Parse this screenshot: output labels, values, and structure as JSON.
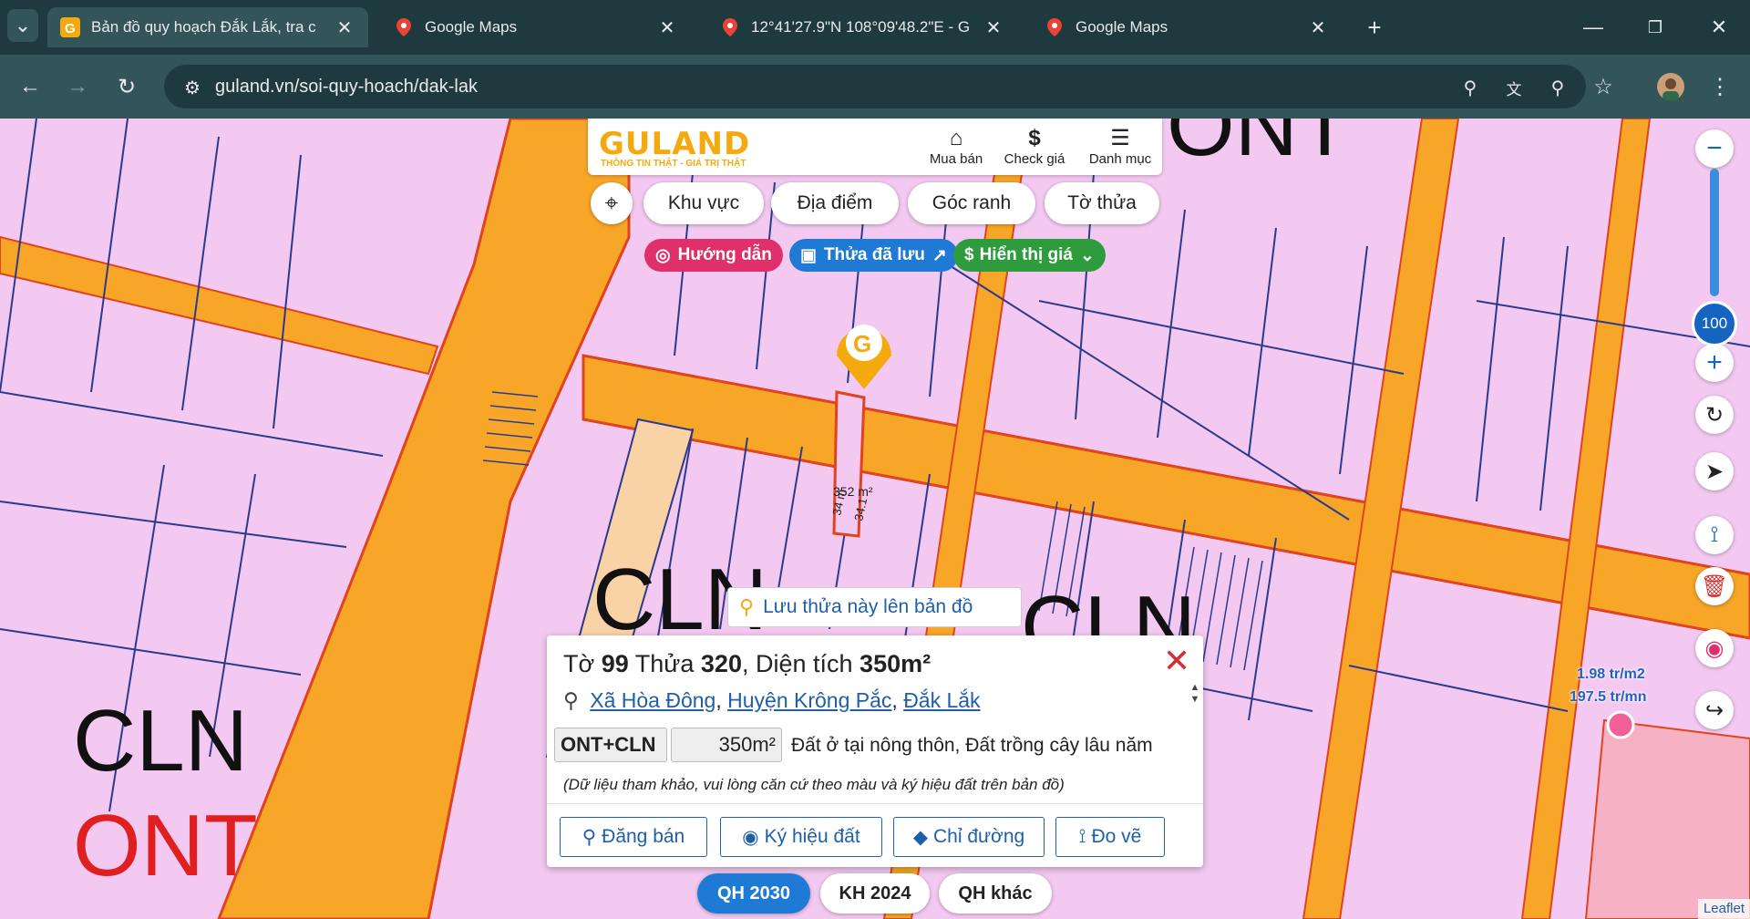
{
  "browser": {
    "tabs": [
      {
        "title": "Bản đồ quy hoạch Đắk Lắk, tra c",
        "icon": "guland-favicon",
        "active": true
      },
      {
        "title": "Google Maps",
        "icon": "google-maps-favicon",
        "active": false
      },
      {
        "title": "12°41'27.9\"N 108°09'48.2\"E - G",
        "icon": "google-maps-favicon",
        "active": false
      },
      {
        "title": "Google Maps",
        "icon": "google-maps-favicon",
        "active": false
      }
    ],
    "url": "guland.vn/soi-quy-hoach/dak-lak"
  },
  "header": {
    "logo": "GULAND",
    "slogan": "THÔNG TIN THẬT - GIÁ TRỊ THẬT",
    "menu": [
      {
        "label": "Mua bán",
        "icon": "house-icon"
      },
      {
        "label": "Check giá",
        "icon": "dollar-icon"
      },
      {
        "label": "Danh mục",
        "icon": "menu-icon"
      }
    ]
  },
  "search_tabs": [
    "Khu vực",
    "Địa điểm",
    "Góc ranh",
    "Tờ thửa"
  ],
  "chips": {
    "guide": "Hướng dẫn",
    "saved": "Thửa đã lưu",
    "price": "Hiển thị giá"
  },
  "zoom_level": "100",
  "map_labels": {
    "parcel_area": "352 m²",
    "edge_left": "34 m",
    "edge_right": "34.1",
    "zone_cln": "CLN",
    "zone_ont": "ONT",
    "price_1": "1.98 tr/m2",
    "price_2": "197.5 tr/mn"
  },
  "save_tooltip": "Lưu thửa này lên bản đồ",
  "parcel": {
    "title_prefix": "Tờ",
    "sheet": "99",
    "plot_label": "Thửa",
    "plot": "320",
    "area_label": ", Diện tích",
    "area": "350m²",
    "commune": "Xã Hòa Đông",
    "district": "Huyện Krông Pắc",
    "province": "Đắk Lắk",
    "land_code": "ONT+CLN",
    "land_area": "350m²",
    "land_desc": "Đất ở tại nông thôn, Đất trồng cây lâu năm",
    "note": "(Dữ liệu tham khảo, vui lòng căn cứ theo màu và ký hiệu đất trên bản đồ)"
  },
  "actions": [
    "Đăng bán",
    "Ký hiệu đất",
    "Chỉ đường",
    "Đo vẽ"
  ],
  "plans": [
    {
      "label": "QH 2030",
      "active": true
    },
    {
      "label": "KH 2024",
      "active": false
    },
    {
      "label": "QH khác",
      "active": false
    }
  ],
  "attribution": "Leaflet",
  "colors": {
    "land_residential_rural": "#f3c9f1",
    "road": "#f7a628",
    "plot_border": "#2b3a8c",
    "accent_blue": "#1e5fa8",
    "guide_chip": "#e0306a",
    "saved_chip": "#1f7ad6",
    "price_chip": "#2e9b3c",
    "brand": "#f4a90f"
  }
}
